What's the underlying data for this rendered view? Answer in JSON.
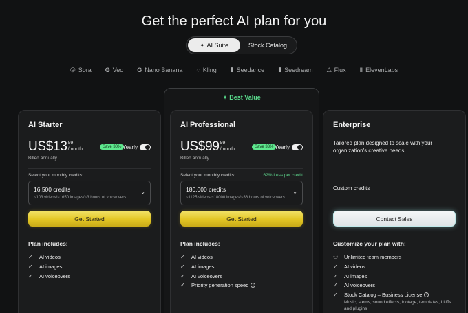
{
  "title": "Get the perfect AI plan for you",
  "tabs": [
    {
      "label": "AI Suite",
      "active": true,
      "icon": "sparkle-icon"
    },
    {
      "label": "Stock Catalog",
      "active": false
    }
  ],
  "models": [
    {
      "label": "Sora",
      "icon": "sora-icon"
    },
    {
      "label": "Veo",
      "icon": "google-icon"
    },
    {
      "label": "Nano Banana",
      "icon": "google-icon"
    },
    {
      "label": "Kling",
      "icon": "kling-icon"
    },
    {
      "label": "Seedance",
      "icon": "seedance-icon"
    },
    {
      "label": "Seedream",
      "icon": "seedream-icon"
    },
    {
      "label": "Flux",
      "icon": "flux-icon"
    },
    {
      "label": "ElevenLabs",
      "icon": "elevenlabs-icon"
    }
  ],
  "best_value_label": "✦ Best Value",
  "plans": {
    "starter": {
      "name": "AI Starter",
      "price": "US$13",
      "cents": "99",
      "per": "/month",
      "save": "Save 30%",
      "yearly": "Yearly",
      "billed": "Billed annually",
      "select_label": "Select your monthly credits:",
      "credits": "16,500 credits",
      "credits_sub": "~103 videos/~1650 images/~3 hours of voiceovers",
      "cta": "Get Started",
      "includes_title": "Plan includes:",
      "features": [
        "AI videos",
        "AI images",
        "AI voiceovers"
      ]
    },
    "pro": {
      "name": "AI Professional",
      "price": "US$99",
      "cents": "99",
      "per": "/month",
      "save": "Save 33%",
      "yearly": "Yearly",
      "billed": "Billed annually",
      "select_label": "Select your monthly credits:",
      "less": "62% Less per credit",
      "credits": "180,000 credits",
      "credits_sub": "~1125 videos/~18000 images/~36 hours of voiceovers",
      "cta": "Get Started",
      "includes_title": "Plan includes:",
      "features": [
        "AI videos",
        "AI images",
        "AI voiceovers",
        "Priority generation speed"
      ]
    },
    "enterprise": {
      "name": "Enterprise",
      "desc": "Tailored plan designed to scale with your organization's creative needs",
      "custom": "Custom credits",
      "cta": "Contact Sales",
      "includes_title": "Customize your plan with:",
      "features": [
        "Unlimited team members",
        "AI videos",
        "AI images",
        "AI voiceovers",
        "Stock Catalog – Business License"
      ],
      "catalog_sub": "Music, stems, sound effects, footage, templates, LUTs and plugins"
    }
  },
  "colors": {
    "accent_green": "#5ed88e",
    "cta_yellow": "#e3c624",
    "background": "#111213"
  }
}
